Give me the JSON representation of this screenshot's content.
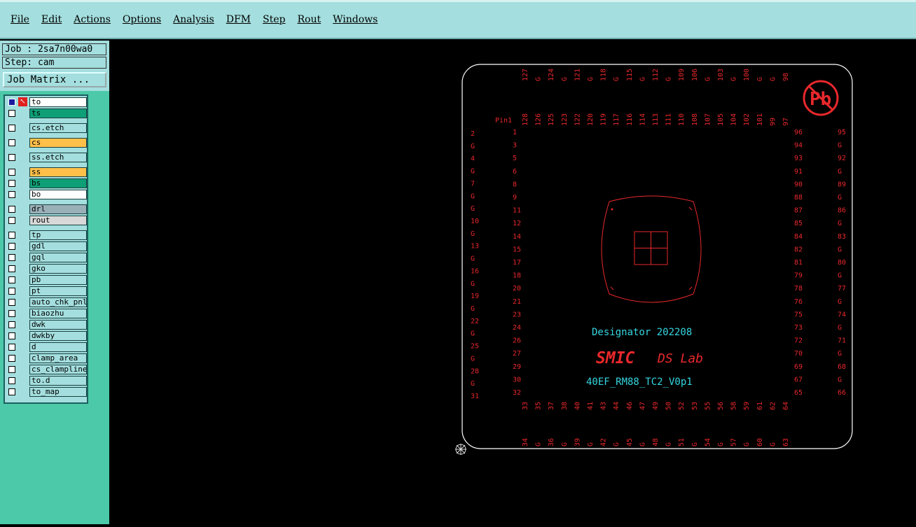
{
  "menu": {
    "items": [
      "File",
      "Edit",
      "Actions",
      "Options",
      "Analysis",
      "DFM",
      "Step",
      "Rout",
      "Windows"
    ]
  },
  "job": {
    "label": "Job : 2sa7n00wa0",
    "step": "Step: cam",
    "matrix_button": "Job Matrix ..."
  },
  "layers": [
    {
      "name": "to",
      "color": "#ffffff",
      "mark": "✎▦"
    },
    {
      "name": "ts",
      "color": "#0e9f77",
      "mark": ""
    },
    {
      "name": "cs.etch",
      "color": "#a4dede",
      "mark": ""
    },
    {
      "name": "cs",
      "color": "#ffc04a",
      "mark": "✎"
    },
    {
      "name": "ss.etch",
      "color": "#a4dede",
      "mark": ""
    },
    {
      "name": "ss",
      "color": "#ffc04a",
      "mark": ""
    },
    {
      "name": "bs",
      "color": "#0e9f77",
      "mark": ""
    },
    {
      "name": "bo",
      "color": "#ffffff",
      "mark": ""
    },
    {
      "name": "drl",
      "color": "#9ab0b8",
      "mark": ""
    },
    {
      "name": "rout",
      "color": "#d8d8d8",
      "mark": ""
    },
    {
      "name": "tp",
      "color": "#a4dede",
      "mark": ""
    },
    {
      "name": "gdl",
      "color": "#a4dede",
      "mark": "✎"
    },
    {
      "name": "gql",
      "color": "#a4dede",
      "mark": ""
    },
    {
      "name": "gko",
      "color": "#a4dede",
      "mark": ""
    },
    {
      "name": "pb",
      "color": "#a4dede",
      "mark": ""
    },
    {
      "name": "pt",
      "color": "#a4dede",
      "mark": ""
    },
    {
      "name": "auto_chk_pnl",
      "color": "#a4dede",
      "mark": ""
    },
    {
      "name": "biaozhu",
      "color": "#a4dede",
      "mark": ""
    },
    {
      "name": "dwk",
      "color": "#a4dede",
      "mark": ""
    },
    {
      "name": "dwkby",
      "color": "#a4dede",
      "mark": ""
    },
    {
      "name": "d",
      "color": "#a4dede",
      "mark": ""
    },
    {
      "name": "clamp_area",
      "color": "#a4dede",
      "mark": ""
    },
    {
      "name": "cs_clampline",
      "color": "#a4dede",
      "mark": ""
    },
    {
      "name": "to.d",
      "color": "#a4dede",
      "mark": "✎"
    },
    {
      "name": "to_map",
      "color": "#a4dede",
      "mark": ""
    }
  ],
  "board": {
    "designator": "Designator 202208",
    "brand": "SMIC",
    "lab": "DS Lab",
    "part": "40EF_RM88_TC2_V0p1",
    "pb_text": "Pb",
    "pin1": "Pin1",
    "top_outer": [
      "127",
      "G",
      "124",
      "G",
      "121",
      "G",
      "118",
      "G",
      "115",
      "G",
      "112",
      "G",
      "109",
      "106",
      "G",
      "103",
      "G",
      "100",
      "G",
      "G",
      "98"
    ],
    "top_inner": [
      "128",
      "126",
      "125",
      "123",
      "122",
      "120",
      "119",
      "117",
      "116",
      "114",
      "113",
      "111",
      "110",
      "108",
      "107",
      "105",
      "104",
      "102",
      "101",
      "99",
      "97"
    ],
    "left_outer": [
      "2",
      "G",
      "4",
      "G",
      "7",
      "G",
      "G",
      "10",
      "G",
      "13",
      "G",
      "16",
      "G",
      "19",
      "G",
      "22",
      "G",
      "25",
      "G",
      "28",
      "G",
      "31"
    ],
    "left_inner": [
      "1",
      "3",
      "5",
      "6",
      "8",
      "9",
      "11",
      "12",
      "14",
      "15",
      "17",
      "18",
      "20",
      "21",
      "23",
      "24",
      "26",
      "27",
      "29",
      "30",
      "32"
    ],
    "right_inner": [
      "96",
      "94",
      "93",
      "91",
      "90",
      "88",
      "87",
      "85",
      "84",
      "82",
      "81",
      "79",
      "78",
      "76",
      "75",
      "73",
      "72",
      "70",
      "69",
      "67",
      "65"
    ],
    "right_outer": [
      "95",
      "G",
      "92",
      "G",
      "89",
      "G",
      "86",
      "G",
      "83",
      "G",
      "80",
      "G",
      "77",
      "G",
      "74",
      "G",
      "71",
      "G",
      "68",
      "G",
      "66"
    ],
    "bottom_inner": [
      "33",
      "35",
      "37",
      "38",
      "40",
      "41",
      "43",
      "44",
      "46",
      "47",
      "49",
      "50",
      "52",
      "53",
      "55",
      "56",
      "58",
      "59",
      "61",
      "62",
      "64"
    ],
    "bottom_outer": [
      "34",
      "G",
      "36",
      "G",
      "39",
      "G",
      "42",
      "G",
      "45",
      "G",
      "48",
      "G",
      "51",
      "G",
      "54",
      "G",
      "57",
      "G",
      "60",
      "G",
      "63"
    ],
    "colors": {
      "pin": "#e8282c",
      "text_cyan": "#35d6e0",
      "outline": "#ffffff",
      "logo": "#e8282c"
    }
  }
}
